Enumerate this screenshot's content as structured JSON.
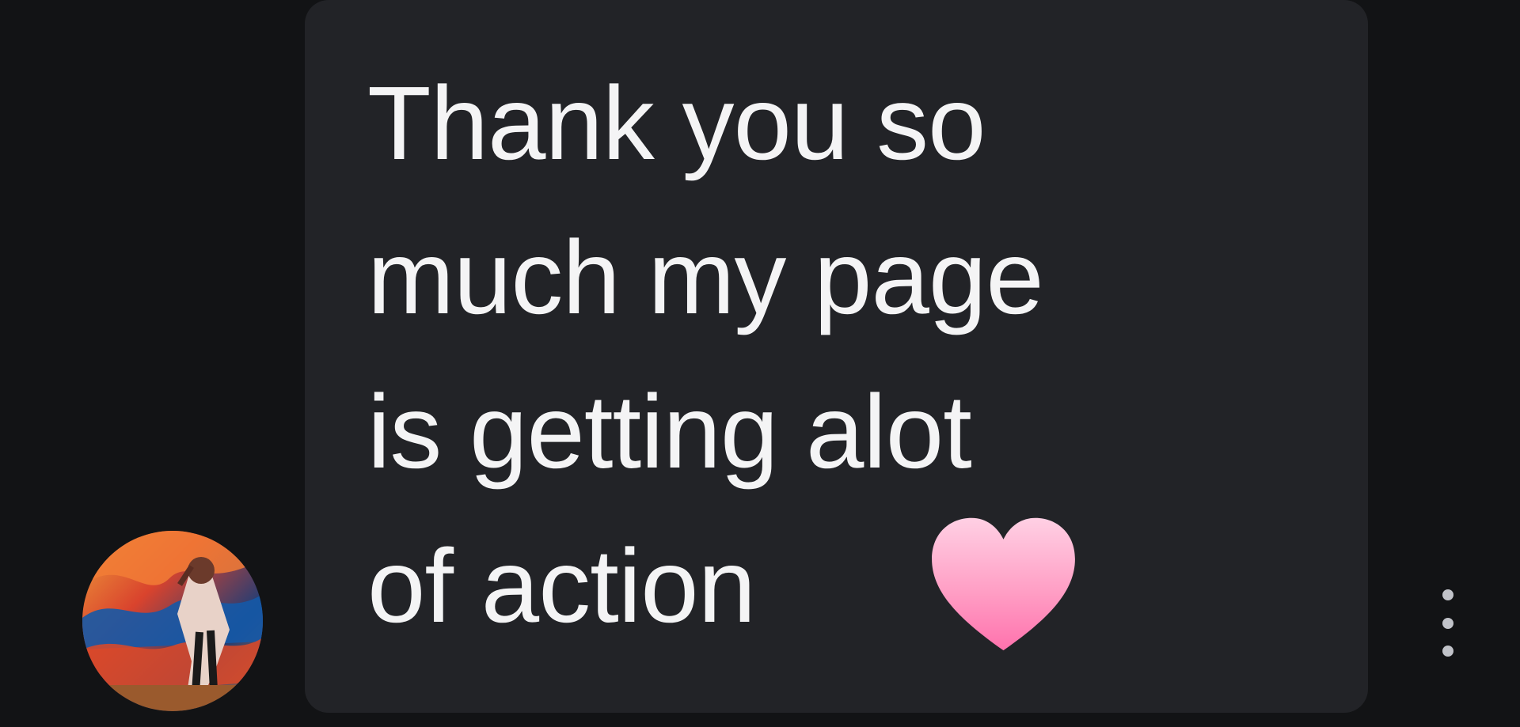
{
  "message": {
    "text": "Thank you so\nmuch my page\nis getting alot\nof action",
    "emoji": "pink-heart"
  },
  "colors": {
    "background": "#121315",
    "bubble": "#222327",
    "text": "#f4f4f5",
    "heart": "#ff8fbd",
    "menu_dots": "#c1c3c9"
  },
  "icons": {
    "avatar": "profile-photo",
    "more_options": "vertical-ellipsis-icon"
  }
}
